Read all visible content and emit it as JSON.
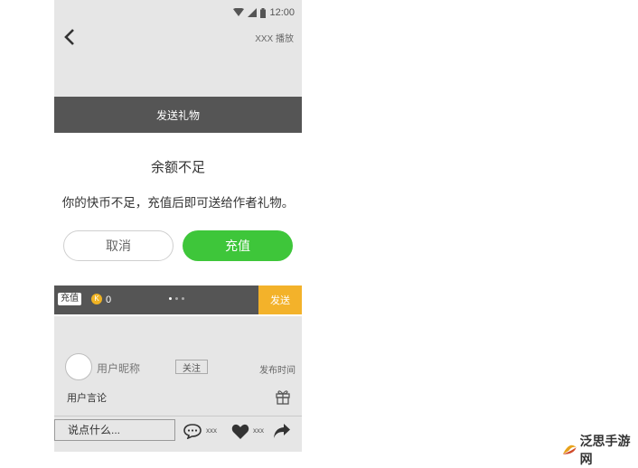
{
  "status_bar": {
    "time": "12:00"
  },
  "top_bar": {
    "play_label": "XXX 播放"
  },
  "gift_panel": {
    "header": "发送礼物",
    "dialog": {
      "title": "余额不足",
      "message": "你的快币不足，充值后即可送给作者礼物。",
      "cancel_label": "取消",
      "recharge_label": "充值"
    },
    "bottom_bar": {
      "recharge_tag": "充值",
      "coin_symbol": "K",
      "coin_count": "0",
      "send_label": "发送"
    }
  },
  "post": {
    "nickname": "用户昵称",
    "follow_label": "关注",
    "post_time": "发布时间",
    "comment_text": "用户言论"
  },
  "input_bar": {
    "placeholder": "说点什么...",
    "comment_count": "xxx",
    "like_count": "xxx"
  },
  "watermark": {
    "text": "泛思手游网"
  },
  "colors": {
    "accent_green": "#3ec63a",
    "send_orange": "#f3b22a",
    "dark_bar": "#555555",
    "background": "#e6e6e6"
  },
  "icons": [
    "back-arrow-icon",
    "wifi-icon",
    "signal-icon",
    "battery-icon",
    "coin-icon",
    "gift-icon",
    "comment-icon",
    "heart-icon",
    "share-icon"
  ]
}
